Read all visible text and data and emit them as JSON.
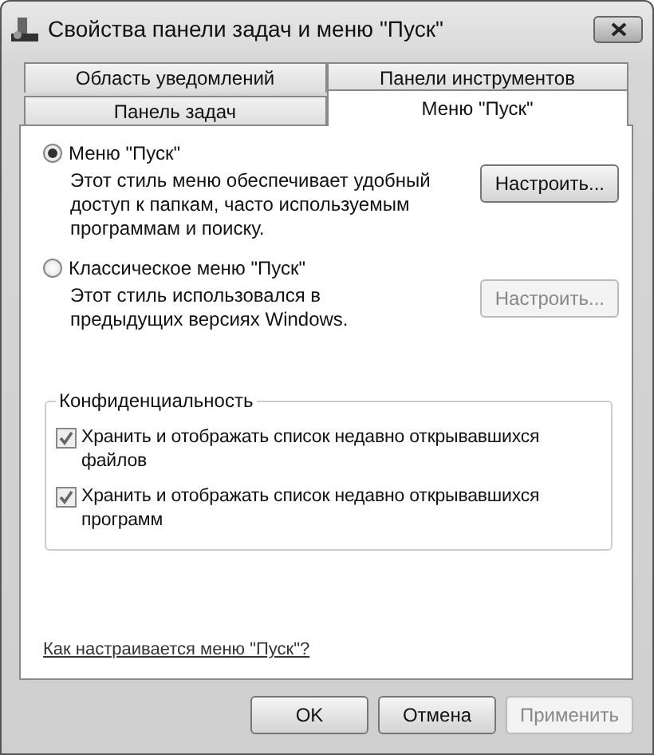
{
  "window": {
    "title": "Свойства панели задач и меню \"Пуск\""
  },
  "tab_rows": [
    [
      {
        "label": "Область уведомлений",
        "selected": false
      },
      {
        "label": "Панели инструментов",
        "selected": false
      }
    ],
    [
      {
        "label": "Панель задач",
        "selected": false
      },
      {
        "label": "Меню \"Пуск\"",
        "selected": true
      }
    ]
  ],
  "start_menu_options": [
    {
      "label": "Меню \"Пуск\"",
      "selected": true,
      "description": "Этот стиль меню обеспечивает удобный доступ к папкам, часто используемым программам и поиску.",
      "button": {
        "label": "Настроить...",
        "disabled": false
      }
    },
    {
      "label": "Классическое меню \"Пуск\"",
      "selected": false,
      "description": "Этот стиль использовался в предыдущих версиях Windows.",
      "button": {
        "label": "Настроить...",
        "disabled": true
      }
    }
  ],
  "privacy": {
    "title": "Конфиденциальность",
    "items": [
      {
        "label": "Хранить и отображать список недавно открывавшихся файлов",
        "checked": true
      },
      {
        "label": "Хранить и отображать список недавно открывавшихся программ",
        "checked": true
      }
    ]
  },
  "help_link": "Как настраивается меню \"Пуск\"?",
  "buttons": [
    {
      "label": "OK",
      "disabled": false
    },
    {
      "label": "Отмена",
      "disabled": false
    },
    {
      "label": "Применить",
      "disabled": true
    }
  ]
}
